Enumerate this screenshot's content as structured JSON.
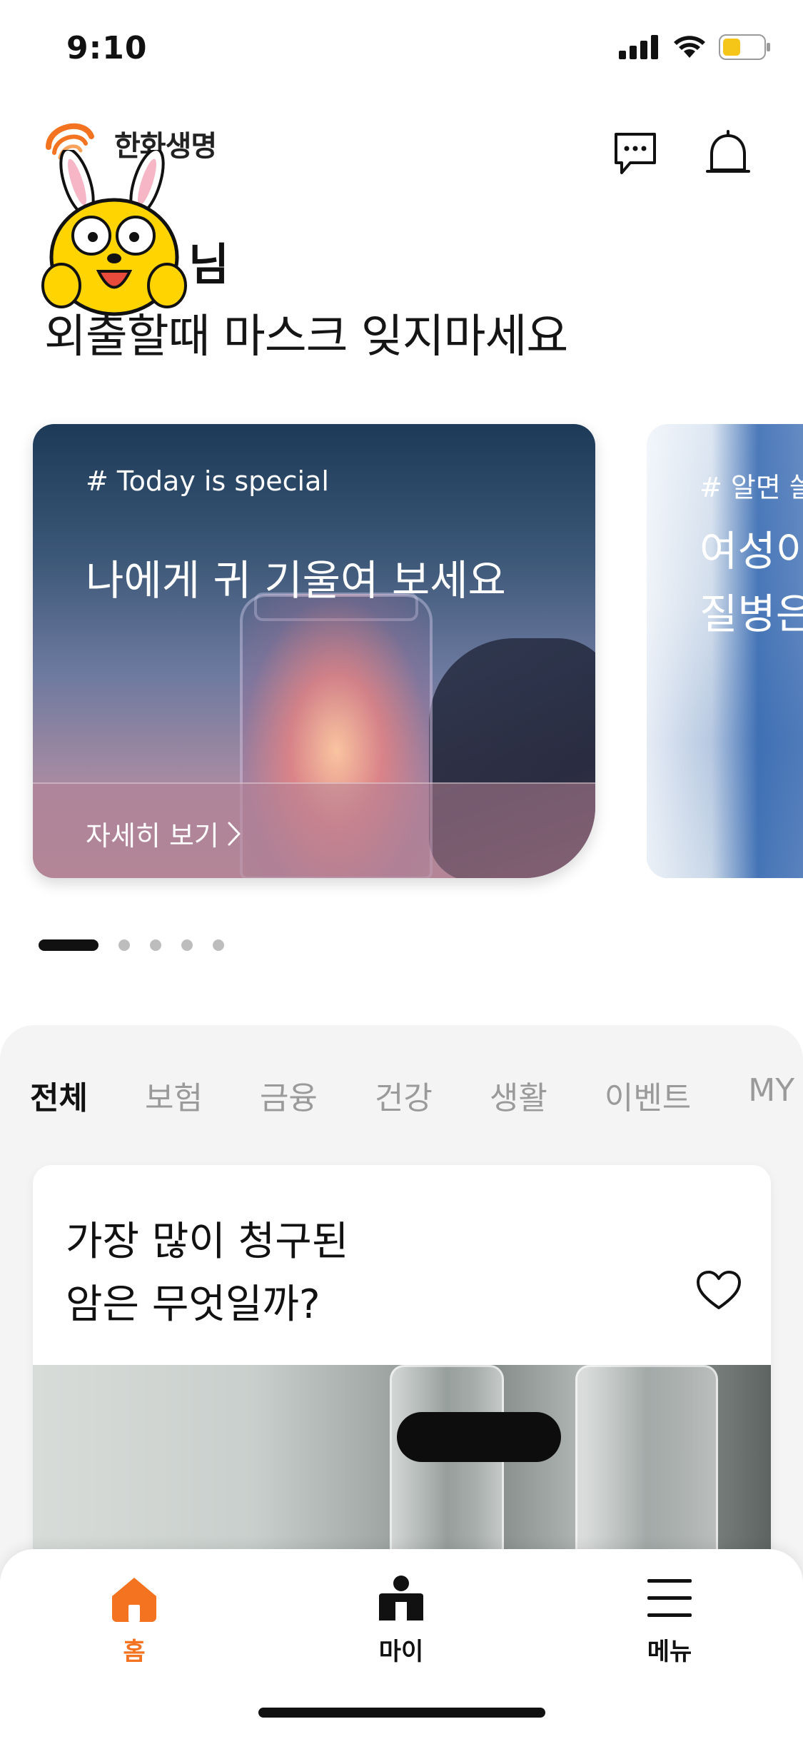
{
  "status_bar": {
    "time": "9:10"
  },
  "header": {
    "brand_name": "한화생명",
    "greeting_suffix": "님",
    "greeting_message": "외출할때 마스크 잊지마세요",
    "chat_icon": "chat-bubble-icon",
    "bell_icon": "bell-icon"
  },
  "carousel": {
    "cards": [
      {
        "tag": "# Today is special",
        "title": "나에게 귀 기울여 보세요",
        "link_label": "자세히 보기"
      },
      {
        "tag": "# 알면 쓸",
        "title_line1": "여성이",
        "title_line2": "질병은"
      }
    ],
    "page_count": 5,
    "active_page": 1
  },
  "feed": {
    "tabs": [
      {
        "label": "전체",
        "active": true
      },
      {
        "label": "보험",
        "active": false
      },
      {
        "label": "금융",
        "active": false
      },
      {
        "label": "건강",
        "active": false
      },
      {
        "label": "생활",
        "active": false
      },
      {
        "label": "이벤트",
        "active": false
      },
      {
        "label": "MY",
        "active": false
      }
    ],
    "card": {
      "title_line1": "가장 많이 청구된",
      "title_line2": "암은 무엇일까?"
    }
  },
  "bottom_nav": {
    "items": [
      {
        "label": "홈",
        "icon": "home-icon",
        "active": true
      },
      {
        "label": "마이",
        "icon": "person-icon",
        "active": false
      },
      {
        "label": "메뉴",
        "icon": "hamburger-menu-icon",
        "active": false
      }
    ]
  },
  "colors": {
    "accent": "#f37321",
    "text": "#111111",
    "tab_inactive": "#9a9a9a",
    "feed_bg": "#f4f4f4"
  }
}
